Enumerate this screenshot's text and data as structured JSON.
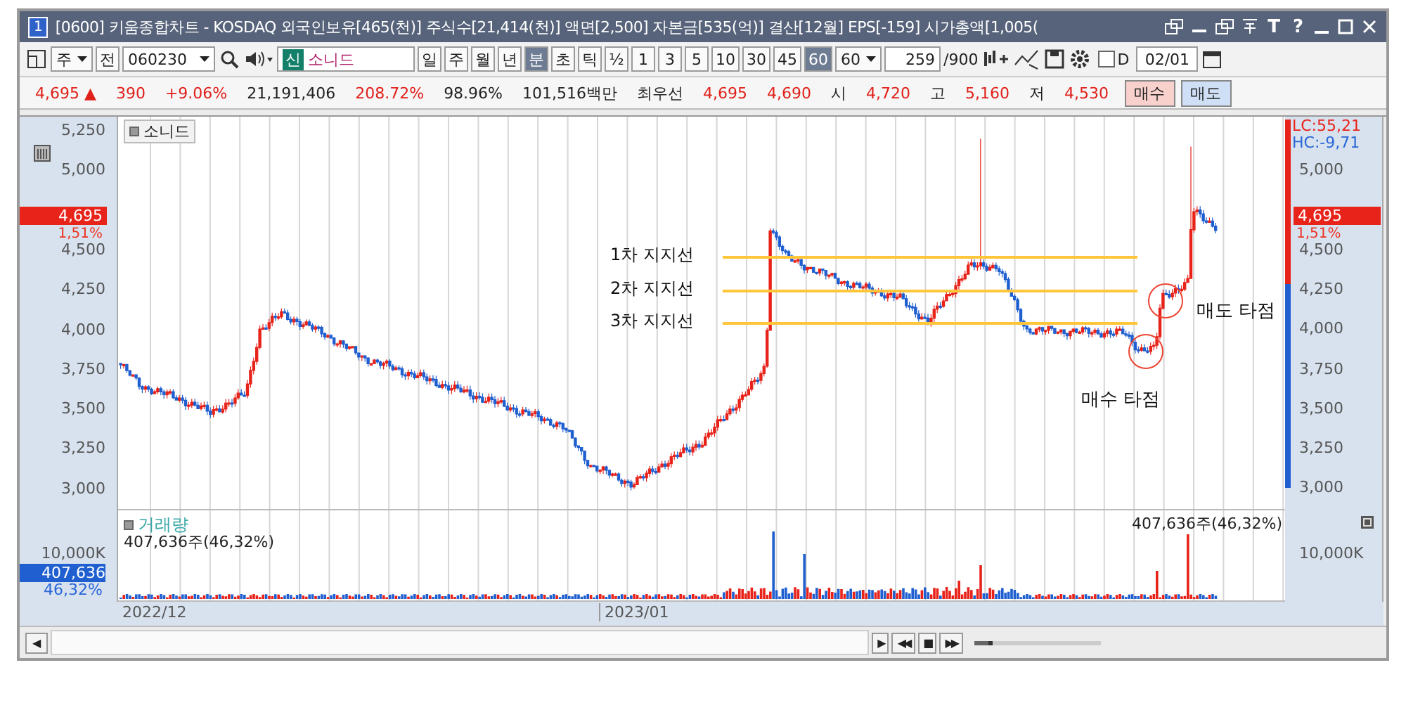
{
  "window": {
    "badge": "1",
    "title": "[0600] 키움종합차트 - KOSDAQ 외국인보유[465(천)] 주식수[21,414(천)] 액면[2,500] 자본금[535(억)] 결산[12월] EPS[-159] 시가총액[1,005(",
    "tools": [
      "T",
      "?"
    ]
  },
  "toolbar": {
    "market": "주",
    "all_button": "전",
    "code": "060230",
    "badge": "신",
    "stock_name": "소니드",
    "periods": [
      {
        "label": "일",
        "selected": false
      },
      {
        "label": "주",
        "selected": false
      },
      {
        "label": "월",
        "selected": false
      },
      {
        "label": "년",
        "selected": false
      },
      {
        "label": "분",
        "selected": true
      },
      {
        "label": "초",
        "selected": false
      },
      {
        "label": "틱",
        "selected": false
      }
    ],
    "intervals": [
      {
        "label": "½",
        "selected": false
      },
      {
        "label": "1",
        "selected": false
      },
      {
        "label": "3",
        "selected": false
      },
      {
        "label": "5",
        "selected": false
      },
      {
        "label": "10",
        "selected": false
      },
      {
        "label": "30",
        "selected": false
      },
      {
        "label": "45",
        "selected": false
      },
      {
        "label": "60",
        "selected": true
      }
    ],
    "interval_select": "60",
    "count": "259",
    "count_max": "/900",
    "daily_check": {
      "label": "D",
      "checked": false
    },
    "date": "02/01"
  },
  "info": [
    {
      "text": "4,695 ▲",
      "kind": "up"
    },
    {
      "text": "390",
      "kind": "up"
    },
    {
      "text": "+9.06%",
      "kind": "up"
    },
    {
      "text": "21,191,406",
      "kind": "plain"
    },
    {
      "text": "208.72%",
      "kind": "up"
    },
    {
      "text": "98.96%",
      "kind": "plain"
    },
    {
      "text": "101,516백만",
      "kind": "plain"
    },
    {
      "text": "최우선",
      "kind": "plain"
    },
    {
      "text": "4,695",
      "kind": "up"
    },
    {
      "text": "4,690",
      "kind": "up"
    },
    {
      "text": "시",
      "kind": "plain"
    },
    {
      "text": "4,720",
      "kind": "up"
    },
    {
      "text": "고",
      "kind": "plain"
    },
    {
      "text": "5,160",
      "kind": "up"
    },
    {
      "text": "저",
      "kind": "plain"
    },
    {
      "text": "4,530",
      "kind": "up"
    }
  ],
  "order_buttons": [
    {
      "label": "매수",
      "kind": "buy"
    },
    {
      "label": "매도",
      "kind": "sell"
    }
  ],
  "chart": {
    "name_tag": "소니드",
    "left_ticks": [
      "5,250",
      "5,000",
      "4,500",
      "4,250",
      "4,000",
      "3,750",
      "3,500",
      "3,250",
      "3,000"
    ],
    "right_ticks": [
      "5,000",
      "4,500",
      "4,250",
      "4,000",
      "3,750",
      "3,500",
      "3,250",
      "3,000"
    ],
    "price_marker_left": {
      "value": "4,695",
      "change": "1,51%"
    },
    "price_marker_right": {
      "value": "4,695",
      "change": "1,51%"
    },
    "lc": "LC:55,21",
    "hc": "HC:-9,71",
    "support_lines": [
      {
        "label": "1차 지지선"
      },
      {
        "label": "2차 지지선"
      },
      {
        "label": "3차 지지선"
      }
    ],
    "notes": [
      {
        "label": "매수 타점",
        "kind": "buy"
      },
      {
        "label": "매도 타점",
        "kind": "sell"
      }
    ],
    "volume": {
      "title": "거래량",
      "reading": "407,636주(46,32%)",
      "reading_right": "407,636주(46,32%)",
      "left_tick": "10,000K",
      "right_tick": "10,000K",
      "marker": "407,636",
      "marker_pct": "46,32%"
    },
    "dates": [
      "2022/12",
      "2023/01"
    ]
  },
  "bottom": {
    "scroll_left": "◀",
    "player": [
      "▶",
      "◀◀",
      "■",
      "▶▶"
    ],
    "slider": {
      "level": 0.12
    }
  }
}
